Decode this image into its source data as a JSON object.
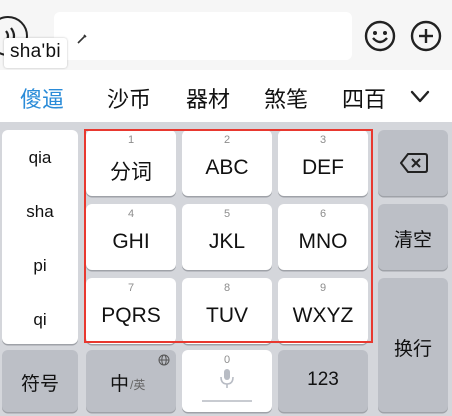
{
  "composition": {
    "text": "sha'bi"
  },
  "candidates": [
    "傻逼",
    "沙币",
    "器材",
    "煞笔",
    "四百"
  ],
  "pinyin_options": [
    "qia",
    "sha",
    "pi",
    "qi"
  ],
  "keys": [
    {
      "num": "1",
      "label": "分词"
    },
    {
      "num": "2",
      "label": "ABC"
    },
    {
      "num": "3",
      "label": "DEF"
    },
    {
      "num": "4",
      "label": "GHI"
    },
    {
      "num": "5",
      "label": "JKL"
    },
    {
      "num": "6",
      "label": "MNO"
    },
    {
      "num": "7",
      "label": "PQRS"
    },
    {
      "num": "8",
      "label": "TUV"
    },
    {
      "num": "9",
      "label": "WXYZ"
    }
  ],
  "right_keys": {
    "clear": "清空",
    "enter": "换行"
  },
  "bottom_keys": {
    "symbols": "符号",
    "lang_main": "中",
    "lang_sub": "/英",
    "space_num": "0",
    "numbers": "123"
  },
  "colors": {
    "first_candidate": "#2a8bd8",
    "highlight_border": "#e8382f",
    "keyboard_bg": "#d4d6db"
  }
}
